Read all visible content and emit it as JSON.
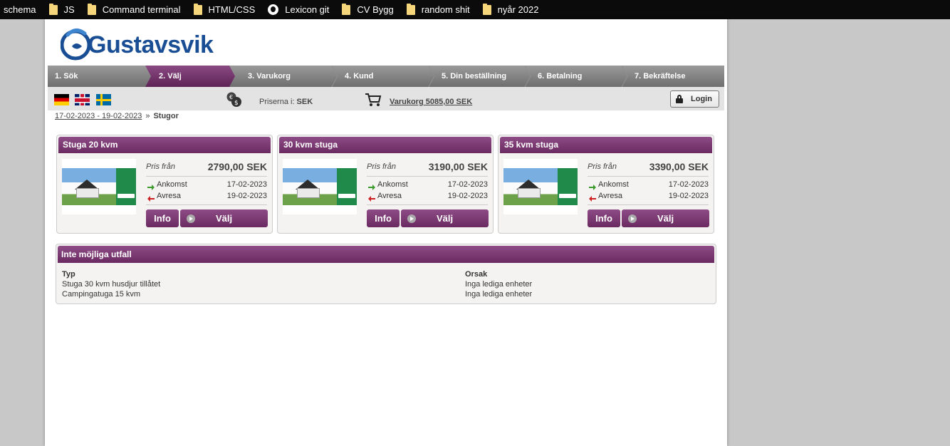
{
  "bookmarks": [
    {
      "label": "schema",
      "icon": "none"
    },
    {
      "label": "JS",
      "icon": "folder-icon"
    },
    {
      "label": "Command terminal",
      "icon": "folder-icon"
    },
    {
      "label": "HTML/CSS",
      "icon": "folder-icon"
    },
    {
      "label": "Lexicon git",
      "icon": "github-icon"
    },
    {
      "label": "CV Bygg",
      "icon": "folder-icon"
    },
    {
      "label": "random shit",
      "icon": "folder-icon"
    },
    {
      "label": "nyår 2022",
      "icon": "folder-icon"
    }
  ],
  "logo": {
    "text": "Gustavsvik"
  },
  "steps": [
    {
      "label": "1. Sök",
      "active": false
    },
    {
      "label": "2. Välj",
      "active": true
    },
    {
      "label": "3. Varukorg",
      "active": false
    },
    {
      "label": "4. Kund",
      "active": false
    },
    {
      "label": "5. Din beställning",
      "active": false
    },
    {
      "label": "6. Betalning",
      "active": false
    },
    {
      "label": "7. Bekräftelse",
      "active": false
    }
  ],
  "toolbar": {
    "prices_label": "Priserna i:",
    "currency": "SEK",
    "cart_label": "Varukorg 5085,00 SEK",
    "login_label": "Login"
  },
  "breadcrumb": {
    "dates": "17-02-2023 - 19-02-2023",
    "separator": "»",
    "current": "Stugor"
  },
  "cards": [
    {
      "title": "Stuga 20 kvm",
      "price_label": "Pris från",
      "price": "2790,00 SEK",
      "arrival_label": "Ankomst",
      "arrival": "17-02-2023",
      "departure_label": "Avresa",
      "departure": "19-02-2023",
      "info_label": "Info",
      "select_label": "Välj"
    },
    {
      "title": "30 kvm stuga",
      "price_label": "Pris från",
      "price": "3190,00 SEK",
      "arrival_label": "Ankomst",
      "arrival": "17-02-2023",
      "departure_label": "Avresa",
      "departure": "19-02-2023",
      "info_label": "Info",
      "select_label": "Välj"
    },
    {
      "title": "35 kvm stuga",
      "price_label": "Pris från",
      "price": "3390,00 SEK",
      "arrival_label": "Ankomst",
      "arrival": "17-02-2023",
      "departure_label": "Avresa",
      "departure": "19-02-2023",
      "info_label": "Info",
      "select_label": "Välj"
    }
  ],
  "unavailable": {
    "title": "Inte möjliga utfall",
    "type_header": "Typ",
    "reason_header": "Orsak",
    "rows": [
      {
        "type": "Stuga 30 kvm husdjur tillåtet",
        "reason": "Inga lediga enheter"
      },
      {
        "type": "Campingatuga 15 kvm",
        "reason": "Inga lediga enheter"
      }
    ]
  },
  "colors": {
    "accent": "#7a3a72",
    "brand_blue": "#1a4e94",
    "step_gray": "#7a7a7a"
  }
}
